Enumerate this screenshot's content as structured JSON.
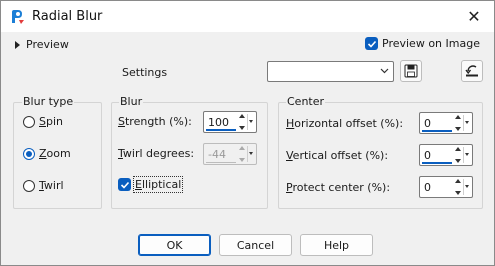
{
  "window": {
    "title": "Radial Blur",
    "close_glyph": "✕"
  },
  "preview_toggle": {
    "label": "Preview"
  },
  "preview_on_image": {
    "label": "Preview on Image",
    "checked": true
  },
  "settings": {
    "label": "Settings",
    "value": ""
  },
  "blur_type": {
    "title": "Blur type",
    "options": [
      {
        "prefix": "",
        "accel": "S",
        "rest": "pin",
        "selected": false
      },
      {
        "prefix": "",
        "accel": "Z",
        "rest": "oom",
        "selected": true
      },
      {
        "prefix": "",
        "accel": "T",
        "rest": "wirl",
        "selected": false
      }
    ]
  },
  "blur": {
    "title": "Blur",
    "strength": {
      "label_accel": "S",
      "label_rest": "trength (%):",
      "value": "100"
    },
    "twirl": {
      "label_accel": "T",
      "label_rest": "wirl degrees:",
      "value": "-44",
      "disabled": true
    },
    "elliptical": {
      "label_accel": "E",
      "label_rest": "lliptical",
      "checked": true
    }
  },
  "center": {
    "title": "Center",
    "horizontal": {
      "label_accel": "H",
      "label_rest": "orizontal offset (%):",
      "value": "0"
    },
    "vertical": {
      "label_accel": "V",
      "label_rest": "ertical offset (%):",
      "value": "0"
    },
    "protect": {
      "label_accel": "P",
      "label_rest": "rotect center (%):",
      "value": "0"
    }
  },
  "buttons": {
    "ok": "OK",
    "cancel": "Cancel",
    "help": "Help"
  },
  "colors": {
    "accent": "#0a5ebf",
    "dialog_bg": "#f0f0f0"
  },
  "icons": [
    "app-icon",
    "close-icon",
    "expand-triangle-icon",
    "checkbox-checked-icon",
    "chevron-down-icon",
    "save-preset-icon",
    "reset-icon"
  ]
}
